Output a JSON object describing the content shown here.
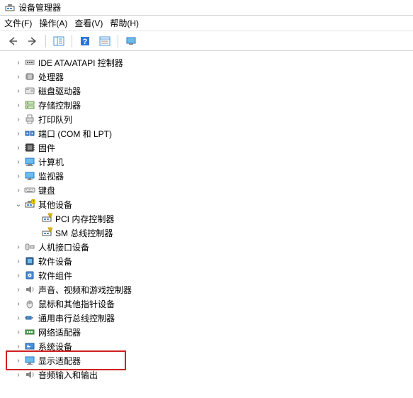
{
  "window": {
    "title": "设备管理器"
  },
  "menu": {
    "file": "文件(F)",
    "action": "操作(A)",
    "view": "查看(V)",
    "help": "帮助(H)"
  },
  "toolbar_icons": {
    "back": "back-arrow-icon",
    "forward": "forward-arrow-icon",
    "details": "details-pane-icon",
    "help": "help-icon",
    "properties": "properties-icon",
    "monitor": "monitor-icon"
  },
  "tree": [
    {
      "label": "IDE ATA/ATAPI 控制器",
      "icon": "ide-controller-icon",
      "expanded": false,
      "hasChildren": true
    },
    {
      "label": "处理器",
      "icon": "chip-icon",
      "expanded": false,
      "hasChildren": true
    },
    {
      "label": "磁盘驱动器",
      "icon": "disk-drive-icon",
      "expanded": false,
      "hasChildren": true
    },
    {
      "label": "存储控制器",
      "icon": "storage-controller-icon",
      "expanded": false,
      "hasChildren": true
    },
    {
      "label": "打印队列",
      "icon": "printer-icon",
      "expanded": false,
      "hasChildren": true
    },
    {
      "label": "端口 (COM 和 LPT)",
      "icon": "port-icon",
      "expanded": false,
      "hasChildren": true
    },
    {
      "label": "固件",
      "icon": "firmware-icon",
      "expanded": false,
      "hasChildren": true
    },
    {
      "label": "计算机",
      "icon": "computer-icon",
      "expanded": false,
      "hasChildren": true
    },
    {
      "label": "监视器",
      "icon": "monitor-icon",
      "expanded": false,
      "hasChildren": true
    },
    {
      "label": "键盘",
      "icon": "keyboard-icon",
      "expanded": false,
      "hasChildren": true
    },
    {
      "label": "其他设备",
      "icon": "other-devices-icon",
      "expanded": true,
      "hasChildren": true,
      "children": [
        {
          "label": "PCI 内存控制器",
          "icon": "unknown-device-icon"
        },
        {
          "label": "SM 总线控制器",
          "icon": "unknown-device-icon"
        }
      ]
    },
    {
      "label": "人机接口设备",
      "icon": "hid-icon",
      "expanded": false,
      "hasChildren": true
    },
    {
      "label": "软件设备",
      "icon": "software-device-icon",
      "expanded": false,
      "hasChildren": true
    },
    {
      "label": "软件组件",
      "icon": "software-component-icon",
      "expanded": false,
      "hasChildren": true
    },
    {
      "label": "声音、视频和游戏控制器",
      "icon": "audio-icon",
      "expanded": false,
      "hasChildren": true
    },
    {
      "label": "鼠标和其他指针设备",
      "icon": "mouse-icon",
      "expanded": false,
      "hasChildren": true
    },
    {
      "label": "通用串行总线控制器",
      "icon": "usb-icon",
      "expanded": false,
      "hasChildren": true
    },
    {
      "label": "网络适配器",
      "icon": "network-icon",
      "expanded": false,
      "hasChildren": true
    },
    {
      "label": "系统设备",
      "icon": "system-device-icon",
      "expanded": false,
      "hasChildren": true
    },
    {
      "label": "显示适配器",
      "icon": "display-adapter-icon",
      "expanded": false,
      "hasChildren": true,
      "highlighted": true
    },
    {
      "label": "音频输入和输出",
      "icon": "speaker-icon",
      "expanded": false,
      "hasChildren": true
    }
  ]
}
